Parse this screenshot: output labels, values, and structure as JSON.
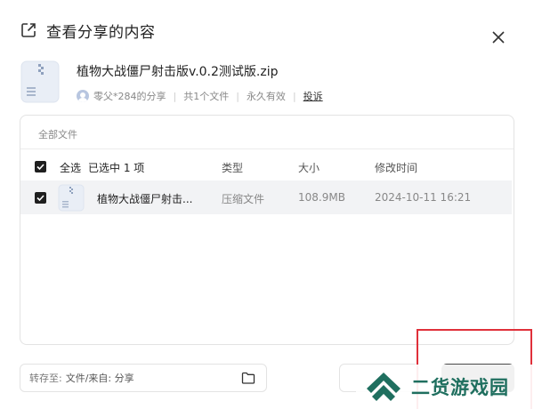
{
  "dialog": {
    "title": "查看分享的内容"
  },
  "file": {
    "name": "植物大战僵尸射击版v.0.2测试版.zip",
    "sharer": "零父*284的分享",
    "count": "共1个文件",
    "validity": "永久有效",
    "report": "投诉"
  },
  "list": {
    "breadcrumb": "全部文件",
    "select_all": "全选",
    "selected_count": "已选中 1 项",
    "columns": {
      "type": "类型",
      "size": "大小",
      "time": "修改时间"
    },
    "rows": [
      {
        "name": "植物大战僵尸射击...",
        "type": "压缩文件",
        "size": "108.9MB",
        "time": "2024-10-11 16:21",
        "checked": true
      }
    ]
  },
  "footer": {
    "save_to_label": "转存至:",
    "save_to_value": "文件/来自: 分享"
  },
  "watermark": {
    "text": "二货游戏园"
  },
  "colors": {
    "highlight_border": "#e0303a",
    "checkbox": "#1f1f1f",
    "watermark_green": "#1f6f5f"
  }
}
